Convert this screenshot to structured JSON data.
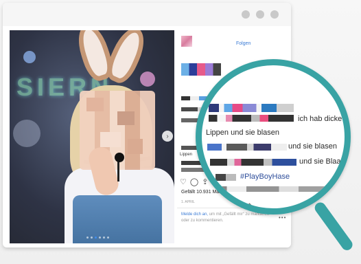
{
  "window": {
    "controls": [
      "dot-1",
      "dot-2",
      "dot-3"
    ]
  },
  "photo": {
    "neon_sign": "SIERN",
    "carousel_total": 6,
    "carousel_active": 2
  },
  "post": {
    "follow_label": "Folgen",
    "caption_preview": "Lippen",
    "likes": "Gefällt 10.931 Mal",
    "date": "1. APRIL",
    "login_link": "Melde dich an,",
    "login_text": "um mit „Gefällt mir“ zu markieren oder zu kommentieren.",
    "more_icon": "ellipsis-icon",
    "icons": [
      "heart-icon",
      "comment-icon",
      "share-icon"
    ]
  },
  "magnifier": {
    "line1": "ich hab dicke",
    "line2": "Lippen und sie blasen",
    "line3": "und sie blasen",
    "line4": "und sie Blaaasen",
    "line5": "#PlayBoyHase"
  },
  "colors": {
    "magnifier_ring": "#39a3a4",
    "link_blue": "#3a7bd5"
  }
}
